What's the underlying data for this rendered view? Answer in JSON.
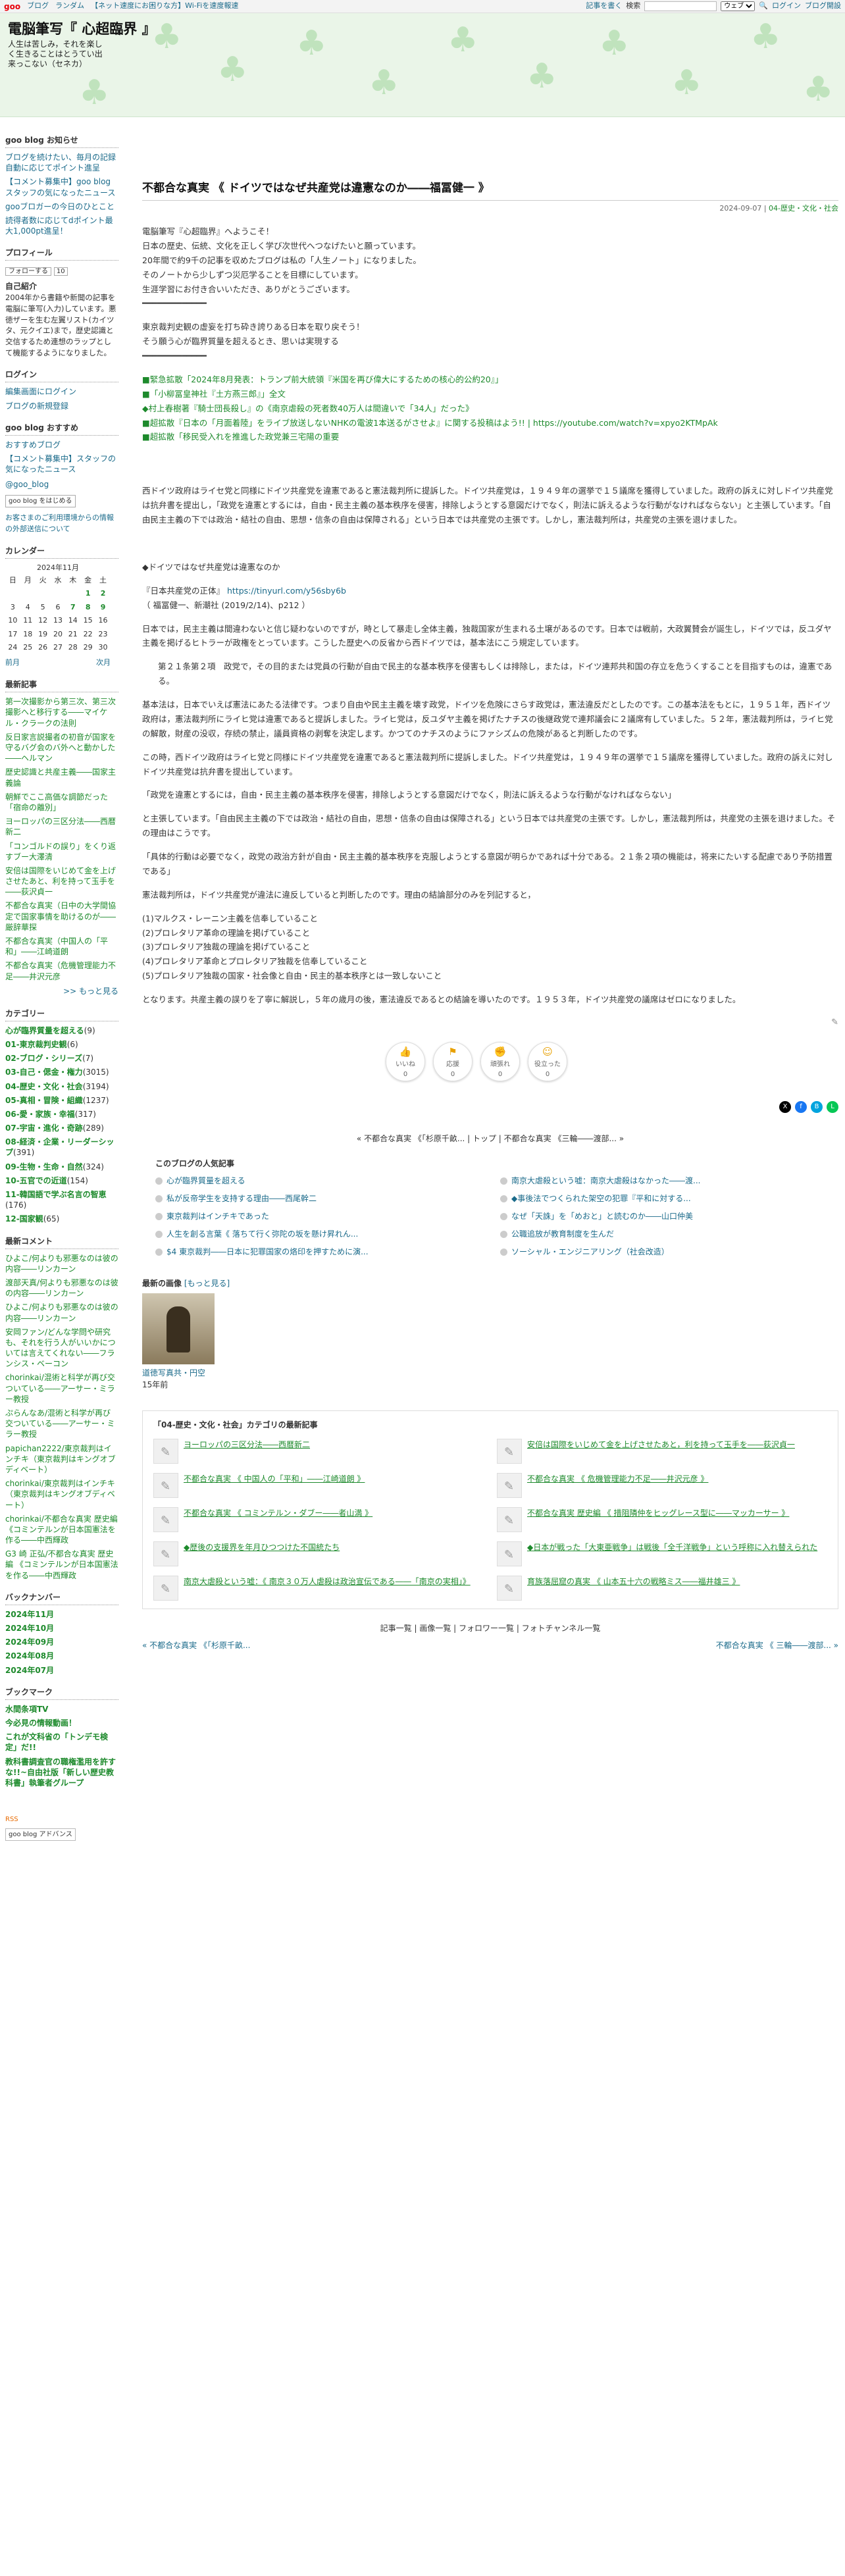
{
  "topbar": {
    "logo": "goo",
    "links": [
      "ブログ",
      "ランダム",
      "【ネット速度にお困りな方】Wi-Fiを速度報速"
    ],
    "bookmark": "記事を書く",
    "search_label": "検索",
    "select_value": "ウェブ",
    "login": "ログイン",
    "blog_help": "ブログ開設"
  },
  "header": {
    "title": "電脳筆写『 心超臨界 』",
    "desc": "人生は苦しみ，それを楽しく生きることはとうてい出来っこない（セネカ）"
  },
  "side": {
    "notice_title": "goo blog お知らせ",
    "notices": [
      "ブログを続けたい、毎月の記録自動に応じてポイント進呈",
      "【コメント募集中】goo blogスタッフの気になったニュース",
      "gooブロガーの今日のひとこと",
      "読得者数に応じてdポイント最大1,000pt進呈！"
    ],
    "profile_title": "プロフィール",
    "follow": "フォローする",
    "follow_count": "10",
    "intro_label": "自己紹介",
    "intro": "2004年から書籍や新聞の記事を電脳に筆写(入力)しています。悪徳ザーを生む左翼リスト(カイツタ、元クイエ)まで，歴史認識と交信するため連想のラップとして機能するようになりました。",
    "login_title": "ログイン",
    "login_links": [
      "編集画面にログイン",
      "ブログの新規登録"
    ],
    "recommend_title": "goo blog おすすめ",
    "recommend": [
      "おすすめブログ",
      "【コメント募集中】スタッフの気になったニュース"
    ],
    "twitter": "@goo_blog",
    "gooblog_start": "goo blog をはじめる",
    "gooblog_note": "お客さまのご利用環境からの情報の外部送信について",
    "cal_title": "カレンダー",
    "cal_month": "2024年11月",
    "cal_days": [
      "日",
      "月",
      "火",
      "水",
      "木",
      "金",
      "土"
    ],
    "cal_rows": [
      [
        "",
        "",
        "",
        "",
        "",
        "1",
        "2"
      ],
      [
        "3",
        "4",
        "5",
        "6",
        "7",
        "8",
        "9"
      ],
      [
        "10",
        "11",
        "12",
        "13",
        "14",
        "15",
        "16"
      ],
      [
        "17",
        "18",
        "19",
        "20",
        "21",
        "22",
        "23"
      ],
      [
        "24",
        "25",
        "26",
        "27",
        "28",
        "29",
        "30"
      ]
    ],
    "cal_prev": "前月",
    "cal_next": "次月",
    "recent_title": "最新記事",
    "recent": [
      "第一次撮影から第三次、第三次撮影へと移行する――マイケル・クラークの法則",
      "反日家言説撮者の初音が国家を守るバグ会のバ外へと動かした――ヘルマン",
      "歴史認識と共産主義――国家主義論",
      "朝鮮でここ高価な調節だった「宿命の離別」",
      "ヨーロッパの三区分法――西暦新二",
      "「コンゴルドの誤り」をくり返すブー大澤清",
      "安倍は国際をいじめて金を上げさせたあと、利を持って玉手を――荻沢貞一",
      "不都合な真実（日中の大学間協定で国家事情を助けるのが――厳辞華探",
      "不都合な真実（中国人の「平和」――江崎道朗",
      "不都合な真実（危機管理能力不足――井沢元彦"
    ],
    "more": ">> もっと見る",
    "cat_title": "カテゴリー",
    "cats": [
      [
        "心が臨界質量を超える",
        "9"
      ],
      [
        "01-東京裁判史観",
        "6"
      ],
      [
        "02-ブログ・シリーズ",
        "7"
      ],
      [
        "03-自己・偲金・権力",
        "3015"
      ],
      [
        "04-歴史・文化・社会",
        "3194"
      ],
      [
        "05-真相・冒険・組織",
        "1237"
      ],
      [
        "06-愛・家族・幸福",
        "317"
      ],
      [
        "07-宇宙・進化・奇跡",
        "289"
      ],
      [
        "08-経済・企業・リーダーシップ",
        "391"
      ],
      [
        "09-生物・生命・自然",
        "324"
      ],
      [
        "10-五官での近道",
        "154"
      ],
      [
        "11-韓国語で学ぶ名言の智恵",
        "176"
      ],
      [
        "12-国家観",
        "65"
      ]
    ],
    "comments_title": "最新コメント",
    "comments": [
      "ひよこ/何よりも邪悪なのは彼の内容――リンカーン",
      "渡部天真/何よりも邪悪なのは彼の内容――リンカーン",
      "ひよこ/何よりも邪悪なのは彼の内容――リンカーン",
      "安岡ファン/どんな学問や研究も、それを行う人がいいかについては言えてくれない――フランシス・ベーコン",
      "chorinkai/混術と科学が再び交ついている――アーサー・ミラー教授",
      "ぷらんなあ/混術と科学が再び交ついている――アーサー・ミラー教授",
      "papichan2222/東京裁判はインチキ（東京裁判はキングオブディベート）",
      "chorinkai/東京裁判はインチキ（東京裁判はキングオブディベート）",
      "chorinkai/不都合な真実 歴史編 《コミンテルンが日本国憲法を作る――中西輝政",
      "G3 崎 正弘/不都合な真実 歴史編 《コミンテルンが日本国憲法を作る――中西輝政"
    ],
    "backnum_title": "バックナンバー",
    "backnums": [
      "2024年11月",
      "2024年10月",
      "2024年09月",
      "2024年08月",
      "2024年07月"
    ],
    "bookmark_title": "ブックマーク",
    "bookmarks": [
      "水間条項TV",
      "今必見の情報動画！",
      "これが文科省の「トンデモ検定」だ!!",
      "教科書調査官の職権濫用を許すな!!~自由社版「新しい歴史教科書」執筆者グループ"
    ],
    "rss": "RSS",
    "footer_logo": "goo blog アドバンス"
  },
  "article": {
    "title": "不都合な真実 《 ドイツではなぜ共産党は違憲なのか――福冨健一 》",
    "date": "2024-09-07",
    "category": "04-歴史・文化・社会",
    "intro": [
      "電脳筆写『心超臨界』へようこそ！",
      "日本の歴史、伝統、文化を正しく学び次世代へつなげたいと願っています。",
      "20年間で約9千の記事を収めたブログは私の「人生ノート」になりました。",
      "そのノートから少しずつ災厄学ることを目標にしています。",
      "生涯学習にお付き合いいただき、ありがとうございます。"
    ],
    "sep": "━━━━━━━━━━━━━",
    "hope1": "東京裁判史観の虚妄を打ち砕き誇りある日本を取り戻そう！",
    "hope2": "そう願う心が臨界質量を超えるとき、思いは実現する",
    "sep2": "━━━━━━━━━━━━━",
    "news": [
      "■緊急拡散「2024年8月発表：トランプ前大統領『米国を再び偉大にするための核心的公約20』」",
      "■「小柳冨皇神社『土方燕三郎』」全文",
      "◆村上春樹著『騎士団長殺し』の《南京虐殺の死者数40万人は間違いで「34人」だった》",
      "■超拡散『日本の「月面着陸」をライブ放送しないNHKの電波1本送るがさせよ』に関する投稿はよう!! | https://youtube.com/watch?v=xpyo2KTMpAk",
      "■超拡散「移民受入れを推進した政党兼三宅陽の重要"
    ],
    "p1": "西ドイツ政府はライセ党と同様にドイツ共産党を違憲であると憲法裁判所に提訴した。ドイツ共産党は，１９４９年の選挙で１５議席を獲得していました。政府の訴えに対しドイツ共産党は抗弁書を提出し，「政党を違憲とするには，自由・民主主義の基本秩序を侵害，排除しようとする意図だけでなく，則法に訴えるような行動がなければならない」と主張しています。「自由民主主義の下では政治・結社の自由、思想・信条の自由は保障される」という日本では共産党の主張です。しかし，憲法裁判所は，共産党の主張を退けました。",
    "p2": "◆ドイツではなぜ共産党は違憲なのか",
    "p3a": "『日本共産党の正体』",
    "p3b": "https://tinyurl.com/y56sby6b",
    "p3c": "（ 福冨健一、新潮社 (2019/2/14)、p212 ）",
    "p4": "日本では，民主主義は間違わないと信じ疑わないのですが，時として暴走し全体主義，独裁国家が生まれる土壌があるのです。日本では戦前，大政翼賛会が誕生し，ドイツでは，反ユダヤ主義を掲げるヒトラーが政権をとっています。こうした歴史への反省から西ドイツでは，基本法にこう規定しています。",
    "p5": "第２１条第２項　政党で，その目的または党員の行動が自由で民主的な基本秩序を侵害もしくは排除し，または，ドイツ連邦共和国の存立を危うくすることを目指すものは，違憲である。",
    "p6": "基本法は，日本でいえば憲法にあたる法律です。つまり自由や民主主義を壊す政党，ドイツを危険にさらす政党は，憲法違反だとしたのです。この基本法をもとに，１９５１年，西ドイツ政府は，憲法裁判所にライヒ党は違憲であると提訴しました。ライヒ党は，反ユダヤ主義を掲げたナチスの後継政党で連邦議会に２議席有していました。５２年，憲法裁判所は，ライヒ党の解散，財産の没収，存続の禁止，議員資格の剥奪を決定します。かつてのナチスのようにファシズムの危険があると判断したのです。",
    "p7": "この時，西ドイツ政府はライヒ党と同様にドイツ共産党を違憲であると憲法裁判所に提訴しました。ドイツ共産党は，１９４９年の選挙で１５議席を獲得していました。政府の訴えに対しドイツ共産党は抗弁書を提出しています。",
    "p8": "「政党を違憲とするには，自由・民主主義の基本秩序を侵害，排除しようとする意図だけでなく，則法に訴えるような行動がなければならない」",
    "p9": "と主張しています。「自由民主主義の下では政治・結社の自由，思想・信条の自由は保障される」という日本では共産党の主張です。しかし，憲法裁判所は，共産党の主張を退けました。その理由はこうです。",
    "p10": "「具体的行動は必要でなく，政党の政治方針が自由・民主主義的基本秩序を克服しようとする意図が明らかであれば十分である。２１条２項の機能は，将来にたいする配慮であり予防措置である」",
    "p11": "憲法裁判所は，ドイツ共産党が違法に違反していると判断したのです。理由の結論部分のみを列記すると，",
    "list": [
      "(1)マルクス・レーニン主義を信奉していること",
      "(2)プロレタリア革命の理論を掲げていること",
      "(3)プロレタリア独裁の理論を掲げていること",
      "(4)プロレタリア革命とプロレタリア独裁を信奉していること",
      "(5)プロレタリア独裁の国家・社会像と自由・民主的基本秩序とは一致しないこと"
    ],
    "p12": "となります。共産主義の誤りを了寧に解説し，５年の歳月の後，憲法違反であるとの結論を導いたのです。１９５３年，ドイツ共産党の議席はゼロになりました。",
    "reactions": [
      [
        "いいね",
        "0"
      ],
      [
        "応援",
        "0"
      ],
      [
        "頑張れ",
        "0"
      ],
      [
        "役立った",
        "0"
      ]
    ],
    "pager": "« 不都合な真実 《「杉原千畝... | トップ | 不都合な真実 《三輪――渡部... »",
    "popular_title": "このブログの人気記事",
    "popular": [
      "心が臨界質量を超える",
      "南京大虐殺という嘘：南京大虐殺はなかった――渡...",
      "私が反帝学生を支持する理由――西尾幹二",
      "◆事後法でつくられた架空の犯罪『平和に対する...",
      "東京裁判はインチキであった",
      "なぜ「天誅」を「めおと」と読むのか――山口仲美",
      "人生を創る言葉《 落ちて行く弥陀の坂を懸け昇れん...",
      "公職追放が教育制度を生んだ",
      "$4 東京裁判――日本に犯罪国家の烙印を押すために演...",
      "ソーシャル・エンジニアリング（社会改造）"
    ],
    "recimg_title": "最新の画像",
    "recimg_more": "[もっと見る]",
    "recimg_caption": "道徳写真共・円空",
    "recimg_age": "15年前",
    "cat_box_title": "「04-歴史・文化・社会」カテゴリの最新記事",
    "cat_items": [
      "ヨーロッパの三区分法――西暦新二",
      "安倍は国際をいじめて金を上げさせたあと，利を持って玉手を――荻沢貞一",
      "不都合な真実 《 中国人の「平和」――江崎道朗 》",
      "不都合な真実 《 危機管理能力不足――井沢元彦 》",
      "不都合な真実 《 コミンテルン・ダブー――者山満 》",
      "不都合な真実 歴史編 《 措阻隣仲をヒッグレース型に――マッカーサー 》",
      "◆歴後の支援界を年月ひつつけた不国統たち",
      "◆日本が戦った「大東亜戦争」は戦後「全千洋戦争」という呼称に入れ替えられた",
      "南京大虐殺という嘘：《 南京３０万人虐殺は政治宣伝である――「南京の実相」》",
      "育族落屈窟の真実 《 山本五十六の戦略ミス――福井雄三 》"
    ],
    "footlinks": "記事一覧 | 画像一覧 | フォロワー一覧 | フォトチャンネル一覧",
    "foot_prev": "« 不都合な真実 《「杉原千畝...",
    "foot_next": "不都合な真実 《 三輪――渡部... »"
  }
}
